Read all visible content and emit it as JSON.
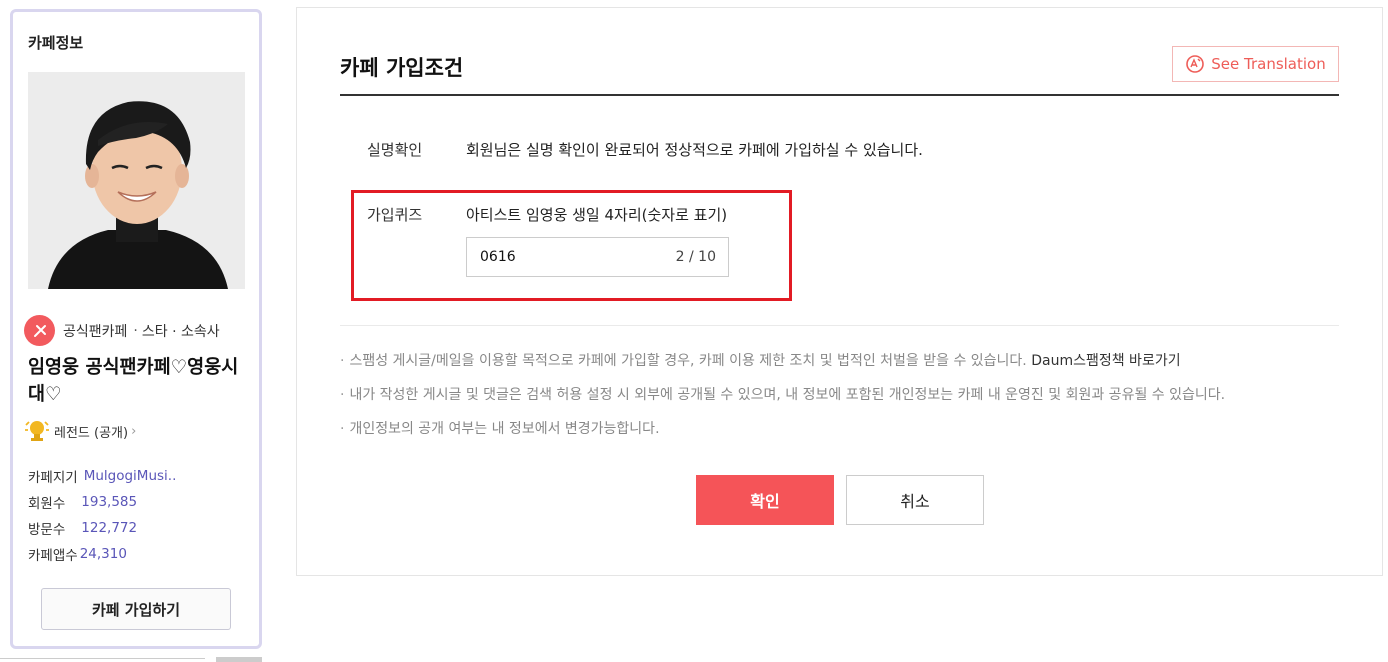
{
  "sidebar": {
    "title": "카페정보",
    "category": {
      "label": "공식팬카페",
      "separator": "·",
      "sub": "스타 · 소속사",
      "badge_color": "#f25a5e"
    },
    "cafe_name": "임영웅 공식팬카페♡영웅시대♡",
    "grade": {
      "label": "레전드 (공개)",
      "chevron": "›"
    },
    "stats": [
      {
        "label": "카페지기",
        "value": "MulgogiMusi.."
      },
      {
        "label": "회원수",
        "value": "193,585"
      },
      {
        "label": "방문수",
        "value": "122,772"
      },
      {
        "label": "카페앱수",
        "value": "24,310"
      }
    ],
    "join_button": "카페 가입하기"
  },
  "main": {
    "title": "카페 가입조건",
    "translate_button": "See Translation",
    "verification": {
      "label": "실명확인",
      "text": "회원님은 실명 확인이 완료되어 정상적으로 카페에 가입하실 수 있습니다."
    },
    "quiz": {
      "label": "가입퀴즈",
      "question": "아티스트 임영웅 생일 4자리(숫자로 표기)",
      "answer": "0616",
      "counter": "2 / 10"
    },
    "notices": [
      {
        "dot": "·",
        "text": "스팸성 게시글/메일을 이용할 목적으로 카페에 가입할 경우, 카페 이용 제한 조치 및 법적인 처벌을 받을 수 있습니다.",
        "link": "Daum스팸정책 바로가기"
      },
      {
        "dot": "·",
        "text": "내가 작성한 게시글 및 댓글은 검색 허용 설정 시 외부에 공개될 수 있으며, 내 정보에 포함된 개인정보는 카페 내 운영진 및 회원과 공유될 수 있습니다."
      },
      {
        "dot": "·",
        "text": "개인정보의 공개 여부는 내 정보에서 변경가능합니다."
      }
    ],
    "confirm_button": "확인",
    "cancel_button": "취소"
  },
  "colors": {
    "accent": "#f55458",
    "highlight_border": "#e21b24",
    "stat_value": "#5a56b8",
    "sidebar_border": "#d9d6ef"
  },
  "icons": [
    "category-star-icon",
    "trophy-icon",
    "translate-icon",
    "profile-photo"
  ]
}
